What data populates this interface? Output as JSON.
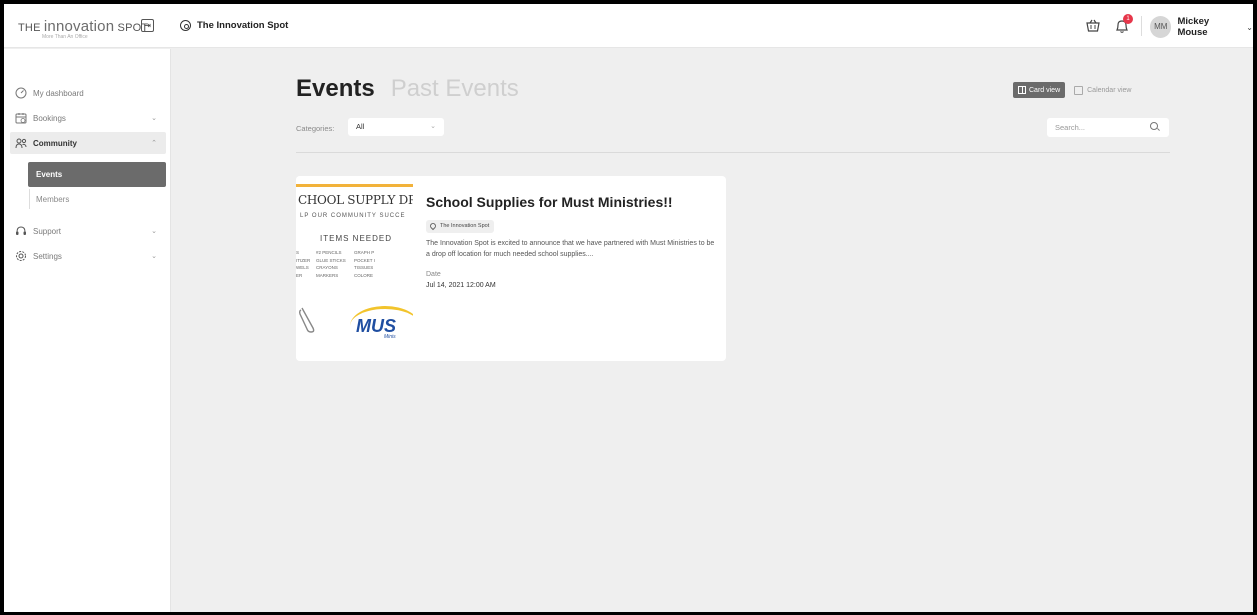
{
  "brand": {
    "logo_the": "THE",
    "logo_name": "innovation",
    "logo_spot": "SPOT",
    "tagline": "More Than An Office"
  },
  "topbar": {
    "collapse_glyph": "⇥",
    "workspace_name": "The Innovation Spot",
    "notification_count": "1",
    "user_initials": "MM",
    "user_name": "Mickey Mouse"
  },
  "sidebar": {
    "items": [
      {
        "label": "My dashboard",
        "icon": "dashboard-icon"
      },
      {
        "label": "Bookings",
        "icon": "calendar-icon"
      },
      {
        "label": "Community",
        "icon": "people-icon"
      },
      {
        "label": "Support",
        "icon": "headset-icon"
      },
      {
        "label": "Settings",
        "icon": "gear-icon"
      }
    ],
    "community_sub": [
      {
        "label": "Events"
      },
      {
        "label": "Members"
      }
    ]
  },
  "main": {
    "tab_events": "Events",
    "tab_past": "Past Events",
    "view_card": "Card view",
    "view_calendar": "Calendar view",
    "categories_label": "Categories:",
    "categories_value": "All",
    "search_placeholder": "Search..."
  },
  "event": {
    "title": "School Supplies for Must Ministries!!",
    "location": "The Innovation Spot",
    "description": "The Innovation Spot is excited to announce that we have partnered with Must Ministries to be a drop off location for much needed school supplies....",
    "date_label": "Date",
    "date_value": "Jul 14, 2021 12:00 AM",
    "thumb": {
      "title": "CHOOL SUPPLY DRIV",
      "subtitle": "LP OUR COMMUNITY SUCCE",
      "items_heading": "ITEMS NEEDED",
      "rows": [
        [
          "S",
          "#2 PENCILS",
          "GRAPH P"
        ],
        [
          "ITIZER",
          "GLUE STICKS",
          "POCKET I"
        ],
        [
          "WELS",
          "CRAYONS",
          "TISSUES"
        ],
        [
          "ER",
          "MARKERS",
          "COLORE"
        ]
      ],
      "logo_text": "MUS",
      "logo_sub": "Minis"
    }
  },
  "colors": {
    "accent_gray": "#6b6b6b",
    "badge_red": "#e6364a",
    "logo_yellow": "#f2c42c",
    "logo_blue": "#1f4ea1"
  }
}
